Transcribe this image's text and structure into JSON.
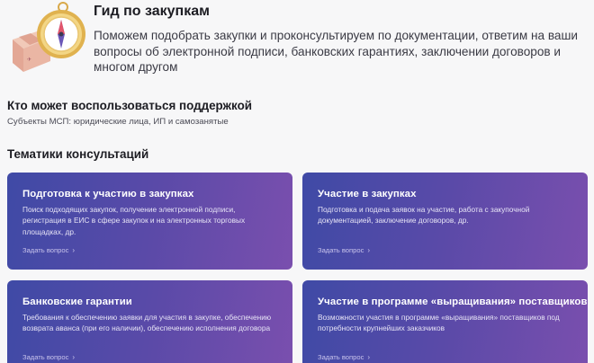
{
  "hero": {
    "title": "Гид по закупкам",
    "description": "Поможем подобрать закупки и проконсультируем по документации, ответим на ваши вопросы об электронной подписи, банковских гарантиях, заключении договоров и многом другом",
    "illustration_icon": "compass-and-box-icon"
  },
  "support": {
    "title": "Кто может воспользоваться поддержкой",
    "subtitle": "Субъекты МСП: юридические лица, ИП и самозанятые"
  },
  "topics": {
    "title": "Тематики консультаций",
    "cards": [
      {
        "title": "Подготовка к участию в закупках",
        "description": "Поиск подходящих закупок, получение электронной подписи, регистрация в ЕИС в сфере закупок и на электронных торговых площадках, др.",
        "link": "Задать вопрос"
      },
      {
        "title": "Участие в закупках",
        "description": "Подготовка и подача заявок на участие, работа с закупочной документацией, заключение договоров, др.",
        "link": "Задать вопрос"
      },
      {
        "title": "Банковские гарантии",
        "description": "Требования к обеспечению заявки для участия в закупке, обеспечению возврата аванса (при его наличии), обеспечению исполнения договора",
        "link": "Задать вопрос"
      },
      {
        "title": "Участие в программе «выращивания» поставщиков",
        "description": "Возможности участия в программе «выращивания» поставщиков под потребности крупнейших заказчиков",
        "link": "Задать вопрос"
      }
    ]
  },
  "colors": {
    "card_gradient_start": "#3f4aa6",
    "card_gradient_end": "#7a4fae",
    "background": "#f7f7f8"
  }
}
